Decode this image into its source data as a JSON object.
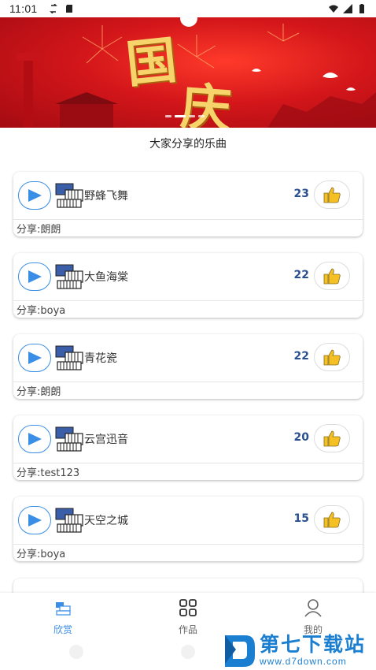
{
  "status_bar": {
    "time": "11:01"
  },
  "banner": {
    "title_char_1": "国",
    "title_char_2": "庆"
  },
  "section_title": "大家分享的乐曲",
  "songs": [
    {
      "name": "野蜂飞舞",
      "likes": "23",
      "sharer": "分享:朗朗"
    },
    {
      "name": "大鱼海棠",
      "likes": "22",
      "sharer": "分享:boya"
    },
    {
      "name": "青花瓷",
      "likes": "22",
      "sharer": "分享:朗朗"
    },
    {
      "name": "云宫迅音",
      "likes": "20",
      "sharer": "分享:test123"
    },
    {
      "name": "天空之城",
      "likes": "15",
      "sharer": "分享:boya"
    }
  ],
  "nav": {
    "home": "欣赏",
    "works": "作品",
    "mine": "我的"
  },
  "watermark": {
    "main": "第七下载站",
    "sub": "www.d7down.com"
  },
  "colors": {
    "accent": "#3a8ee6",
    "like_count": "#2a4f8f",
    "banner_red": "#d3161a",
    "watermark_blue": "#1b7fd1"
  },
  "icons": {
    "play": "play-icon",
    "piano": "piano-keys-icon",
    "like": "thumbs-up-icon",
    "home": "music-scene-icon",
    "works": "grid-icon",
    "mine": "person-icon"
  }
}
